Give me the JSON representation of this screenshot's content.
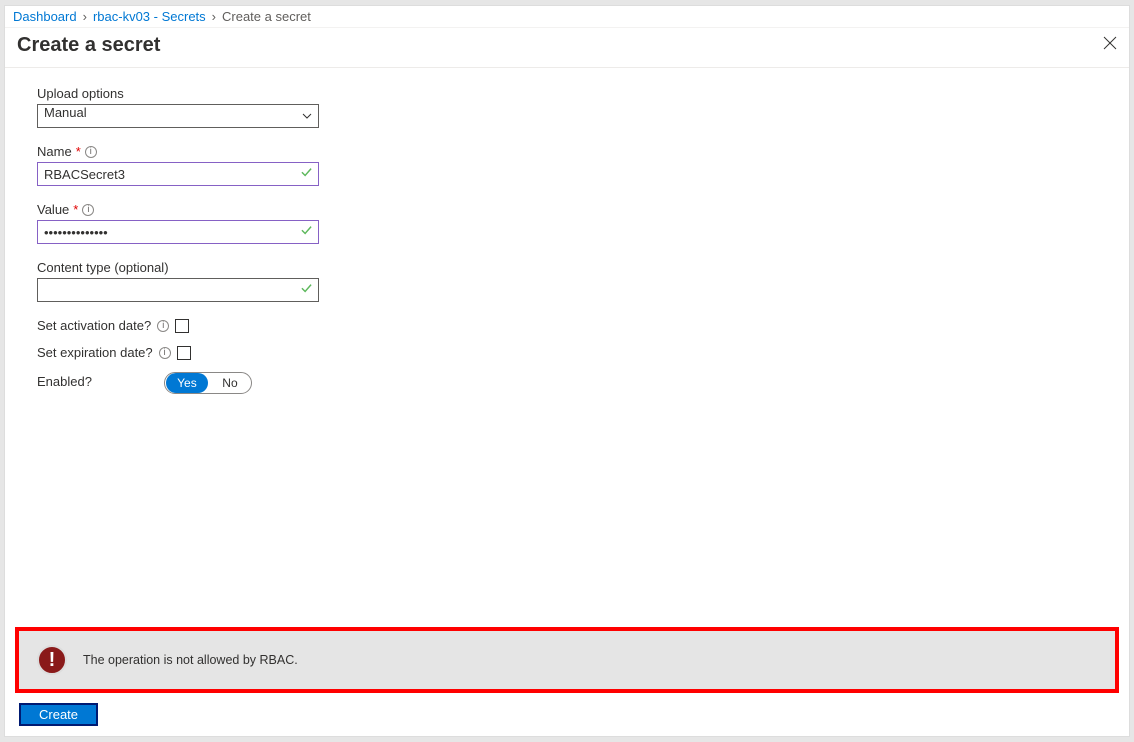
{
  "breadcrumb": {
    "items": [
      "Dashboard",
      "rbac-kv03 - Secrets",
      "Create a secret"
    ]
  },
  "header": {
    "title": "Create a secret"
  },
  "form": {
    "uploadOptions": {
      "label": "Upload options",
      "value": "Manual"
    },
    "name": {
      "label": "Name",
      "value": "RBACSecret3"
    },
    "value": {
      "label": "Value",
      "value": "••••••••••••••"
    },
    "contentType": {
      "label": "Content type (optional)",
      "value": ""
    },
    "activation": {
      "label": "Set activation date?"
    },
    "expiration": {
      "label": "Set expiration date?"
    },
    "enabled": {
      "label": "Enabled?",
      "yes": "Yes",
      "no": "No"
    }
  },
  "error": {
    "message": "The operation is not allowed by RBAC."
  },
  "actions": {
    "create": "Create"
  }
}
